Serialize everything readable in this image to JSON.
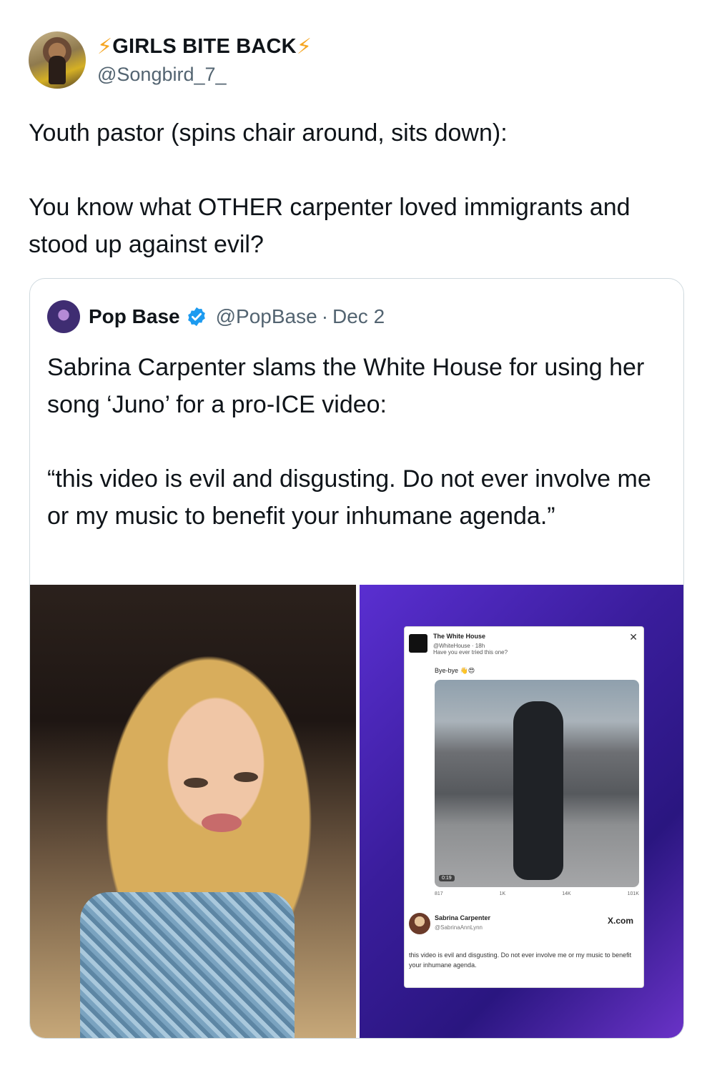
{
  "author": {
    "display_name": "GIRLS BITE BACK",
    "handle": "@Songbird_7_"
  },
  "tweet": {
    "text": "Youth pastor (spins chair around, sits down):\n\nYou know what OTHER carpenter loved immigrants and stood up against evil?"
  },
  "quoted": {
    "name": "Pop Base",
    "handle": "@PopBase",
    "date": "Dec 2",
    "text": "Sabrina Carpenter slams the White House for using her song ‘Juno’ for a pro-ICE video:\n\n“this video is evil and disgusting. Do not ever involve me or my music to benefit your inhumane agenda.”"
  },
  "embedded_card": {
    "wh_name": "The White House",
    "wh_meta": "@WhiteHouse · 18h",
    "wh_text": "Have you ever tried this one?",
    "byebye": "Bye-bye 👋😍",
    "video_time": "0:19",
    "stats": [
      "817",
      "1K",
      "14K",
      "101K"
    ],
    "sc_name": "Sabrina Carpenter",
    "sc_handle": "@SabrinaAnnLynn",
    "xcom": "X.com",
    "sc_quote": "this video is evil and disgusting. Do not ever involve me or my music to benefit your inhumane agenda."
  },
  "colors": {
    "verified": "#1d9bf0",
    "bolt": "#f5a623",
    "secondary_text": "#536471"
  }
}
